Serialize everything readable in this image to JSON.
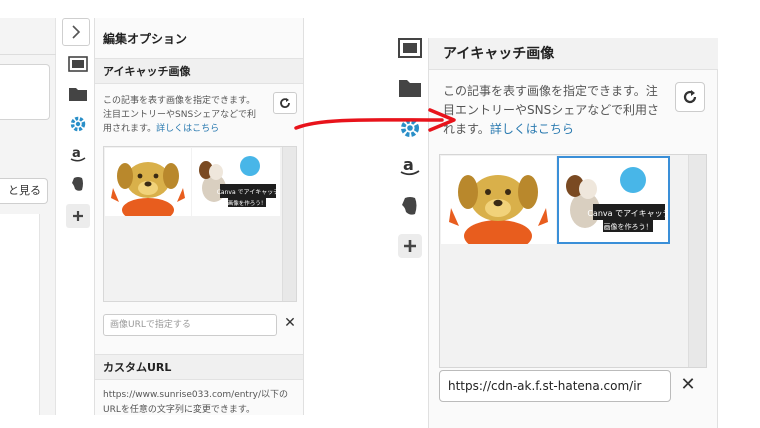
{
  "left": {
    "editor": {
      "view_button_label": "と見る"
    },
    "panel": {
      "title": "編集オプション",
      "eyecatch": {
        "heading": "アイキャッチ画像",
        "description": "この記事を表す画像を指定できます。注目エントリーやSNSシェアなどで利用されます。",
        "link_label": "詳しくはこちら",
        "url_placeholder": "画像URLで指定する",
        "thumb_text": "Canvaでアイキャッチ画像を作ろう！"
      },
      "custom_url": {
        "heading": "カスタムURL",
        "description": "https://www.sunrise033.com/entry/以下のURLを任意の文字列に変更できます。"
      }
    },
    "icons": [
      "chevron-right-icon",
      "image-icon",
      "folder-icon",
      "gear-icon",
      "amazon-icon",
      "evernote-icon",
      "plus-icon"
    ]
  },
  "right": {
    "panel": {
      "heading": "アイキャッチ画像",
      "description": "この記事を表す画像を指定できます。注目エントリーやSNSシェアなどで利用されます。",
      "link_label": "詳しくはこちら",
      "url_value": "https://cdn-ak.f.st-hatena.com/ir",
      "thumb_text": "Canvaでアイキャッチ画像を作ろう！"
    },
    "icons": [
      "image-icon",
      "folder-icon",
      "gear-icon",
      "amazon-icon",
      "evernote-icon",
      "plus-icon"
    ]
  },
  "colors": {
    "arrow": "#e8131b",
    "link": "#2a7ab0",
    "selected_border": "#3a8fd8",
    "accent_gear": "#2a8fc8"
  }
}
